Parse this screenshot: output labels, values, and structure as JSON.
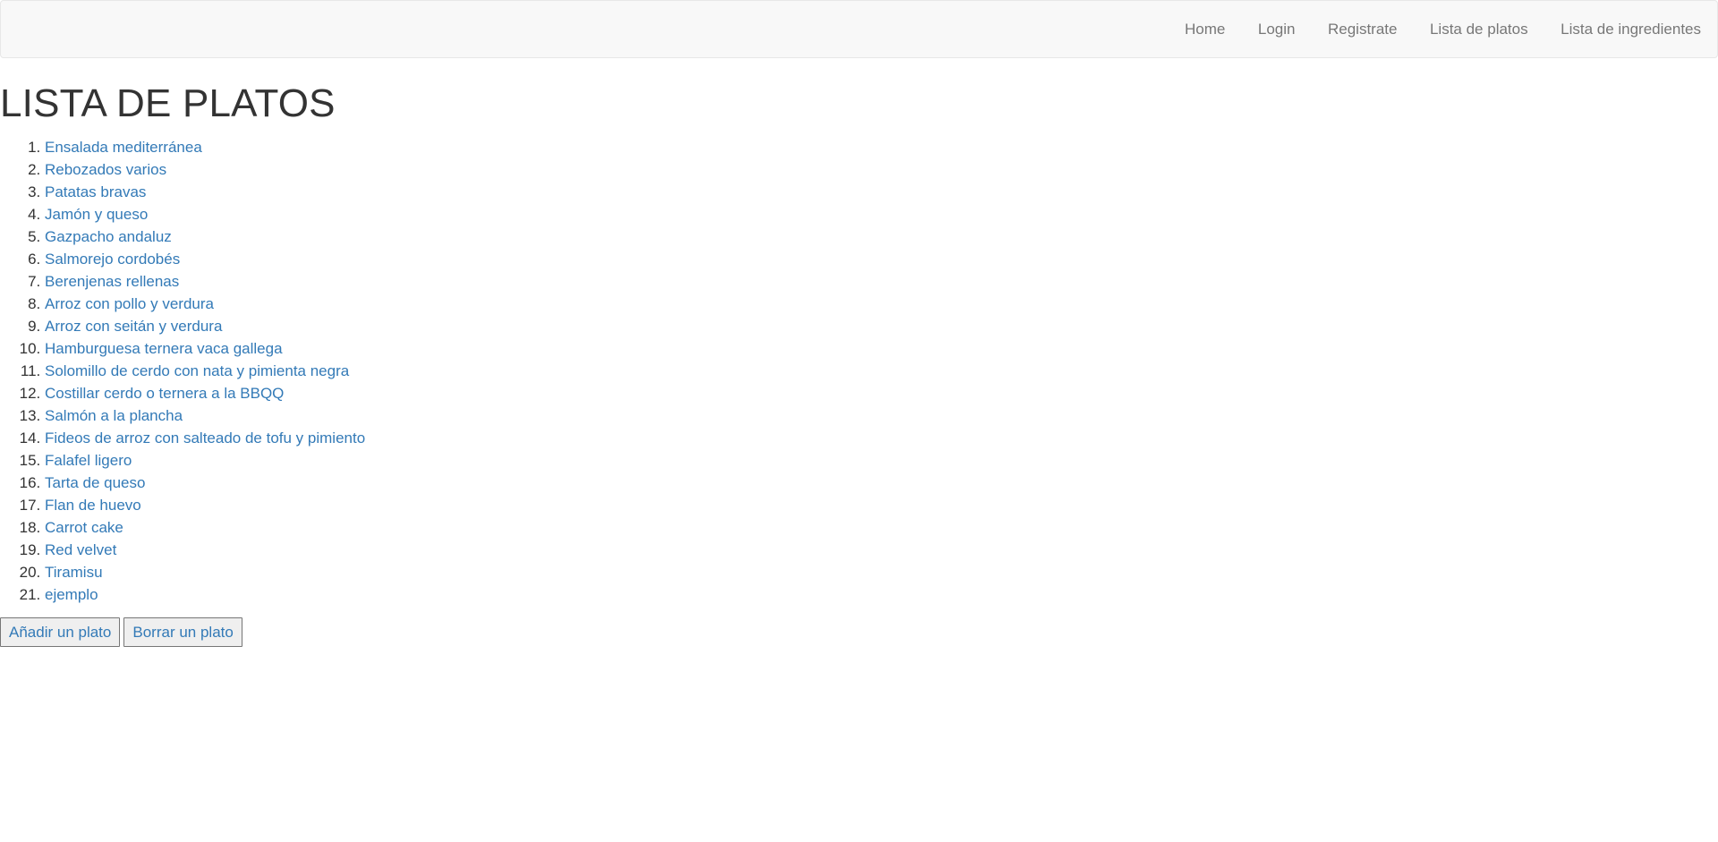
{
  "navbar": {
    "links": [
      "Home",
      "Login",
      "Registrate",
      "Lista de platos",
      "Lista de ingredientes"
    ]
  },
  "page": {
    "title": "LISTA DE PLATOS"
  },
  "dishes": [
    "Ensalada mediterránea",
    "Rebozados varios",
    "Patatas bravas",
    "Jamón y queso",
    "Gazpacho andaluz",
    "Salmorejo cordobés",
    "Berenjenas rellenas",
    "Arroz con pollo y verdura",
    "Arroz con seitán y verdura",
    "Hamburguesa ternera vaca gallega",
    "Solomillo de cerdo con nata y pimienta negra",
    "Costillar cerdo o ternera a la BBQQ",
    "Salmón a la plancha",
    "Fideos de arroz con salteado de tofu y pimiento",
    "Falafel ligero",
    "Tarta de queso",
    "Flan de huevo",
    "Carrot cake",
    "Red velvet",
    "Tiramisu",
    "ejemplo"
  ],
  "actions": {
    "add_label": "Añadir un plato",
    "delete_label": "Borrar un plato"
  },
  "colors": {
    "link": "#337ab7",
    "nav_text": "#777777",
    "navbar_bg": "#f8f8f8",
    "text": "#333333"
  }
}
